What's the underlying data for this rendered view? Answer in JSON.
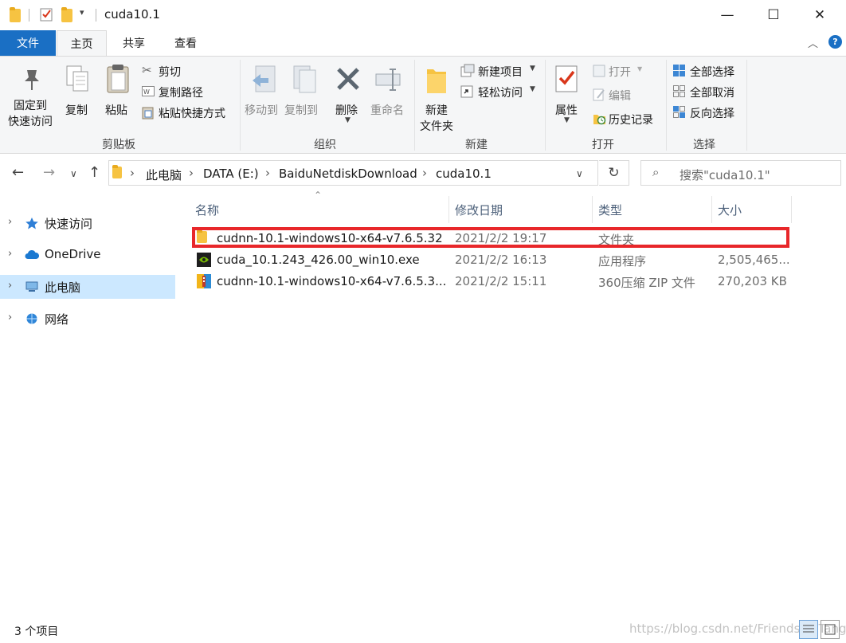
{
  "window": {
    "title": "cuda10.1",
    "quick_access_dropdown": "▾",
    "minimize": "—",
    "maximize": "☐",
    "close": "✕"
  },
  "tabs": [
    {
      "label": "文件"
    },
    {
      "label": "主页"
    },
    {
      "label": "共享"
    },
    {
      "label": "查看"
    }
  ],
  "ribbon": {
    "clipboard": {
      "pin_line1": "固定到",
      "pin_line2": "快速访问",
      "copy": "复制",
      "paste": "粘贴",
      "cut": "剪切",
      "copy_path": "复制路径",
      "paste_shortcut": "粘贴快捷方式",
      "group_label": "剪贴板"
    },
    "organize": {
      "move_to": "移动到",
      "copy_to": "复制到",
      "delete": "删除",
      "rename": "重命名",
      "group_label": "组织"
    },
    "new": {
      "new_folder_line1": "新建",
      "new_folder_line2": "文件夹",
      "new_item": "新建项目",
      "easy_access": "轻松访问",
      "group_label": "新建"
    },
    "open": {
      "properties": "属性",
      "open": "打开",
      "edit": "编辑",
      "history": "历史记录",
      "group_label": "打开"
    },
    "select": {
      "select_all": "全部选择",
      "select_none": "全部取消",
      "invert": "反向选择",
      "group_label": "选择"
    }
  },
  "address": {
    "breadcrumbs": [
      "此电脑",
      "DATA (E:)",
      "BaiduNetdiskDownload",
      "cuda10.1"
    ],
    "search_placeholder": "搜索\"cuda10.1\""
  },
  "nav": [
    {
      "label": "快速访问",
      "icon": "star-icon"
    },
    {
      "label": "OneDrive",
      "icon": "cloud-icon"
    },
    {
      "label": "此电脑",
      "icon": "computer-icon",
      "selected": true
    },
    {
      "label": "网络",
      "icon": "network-icon"
    }
  ],
  "columns": {
    "name": "名称",
    "date": "修改日期",
    "type": "类型",
    "size": "大小"
  },
  "files": [
    {
      "name": "cudnn-10.1-windows10-x64-v7.6.5.32",
      "date": "2021/2/2 19:17",
      "type": "文件夹",
      "size": "",
      "icon": "folder-icon"
    },
    {
      "name": "cuda_10.1.243_426.00_win10.exe",
      "date": "2021/2/2 16:13",
      "type": "应用程序",
      "size": "2,505,465...",
      "icon": "nvidia-exe-icon"
    },
    {
      "name": "cudnn-10.1-windows10-x64-v7.6.5.3...",
      "date": "2021/2/2 15:11",
      "type": "360压缩 ZIP 文件",
      "size": "270,203 KB",
      "icon": "zip-archive-icon"
    }
  ],
  "status": {
    "item_count": "3 个项目",
    "watermark": "https://blog.csdn.net/FriendshipTang"
  },
  "colors": {
    "accent": "#1a6fc4",
    "highlight_box": "#e8272a",
    "nav_selected": "#cce8ff"
  }
}
